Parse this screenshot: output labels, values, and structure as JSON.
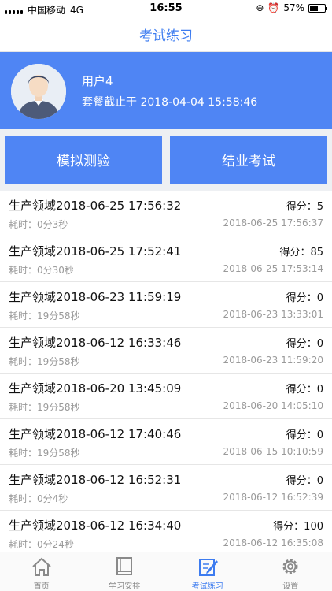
{
  "status_bar": {
    "carrier": "中国移动",
    "network": "4G",
    "time": "16:55",
    "battery": "57%",
    "battery_level": 0.57
  },
  "nav": {
    "title": "考试练习"
  },
  "profile": {
    "name": "用户4",
    "expiry": "套餐截止于 2018-04-04 15:58:46"
  },
  "buttons": {
    "mock": "模拟测验",
    "final": "结业考试"
  },
  "records": [
    {
      "title": "生产领域2018-06-25 17:56:32",
      "score": "得分：5",
      "duration": "耗时：0分3秒",
      "date": "2018-06-25 17:56:37"
    },
    {
      "title": "生产领域2018-06-25 17:52:41",
      "score": "得分：85",
      "duration": "耗时：0分30秒",
      "date": "2018-06-25 17:53:14"
    },
    {
      "title": "生产领域2018-06-23 11:59:19",
      "score": "得分：0",
      "duration": "耗时：19分58秒",
      "date": "2018-06-23 13:33:01"
    },
    {
      "title": "生产领域2018-06-12 16:33:46",
      "score": "得分：0",
      "duration": "耗时：19分58秒",
      "date": "2018-06-23 11:59:20"
    },
    {
      "title": "生产领域2018-06-20 13:45:09",
      "score": "得分：0",
      "duration": "耗时：19分58秒",
      "date": "2018-06-20 14:05:10"
    },
    {
      "title": "生产领域2018-06-12 17:40:46",
      "score": "得分：0",
      "duration": "耗时：19分58秒",
      "date": "2018-06-15 10:10:59"
    },
    {
      "title": "生产领域2018-06-12 16:52:31",
      "score": "得分：0",
      "duration": "耗时：0分4秒",
      "date": "2018-06-12 16:52:39"
    },
    {
      "title": "生产领域2018-06-12 16:34:40",
      "score": "得分：100",
      "duration": "耗时：0分24秒",
      "date": "2018-06-12 16:35:08"
    }
  ],
  "tabs": [
    {
      "label": "首页",
      "icon": "home-icon"
    },
    {
      "label": "学习安排",
      "icon": "book-icon"
    },
    {
      "label": "考试练习",
      "icon": "edit-icon"
    },
    {
      "label": "设置",
      "icon": "gear-icon"
    }
  ],
  "colors": {
    "accent": "#4f85f4",
    "title": "#3d7cf0",
    "muted": "#9a9a9a"
  }
}
